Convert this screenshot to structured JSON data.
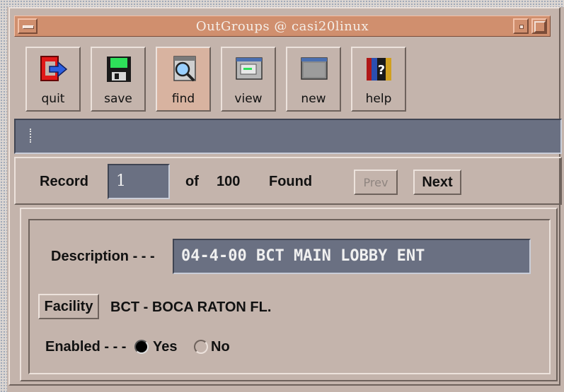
{
  "window": {
    "title": "OutGroups @ casi20linux"
  },
  "toolbar": {
    "buttons": [
      {
        "label": "quit",
        "icon": "quit-exit-icon"
      },
      {
        "label": "save",
        "icon": "floppy-disk-icon"
      },
      {
        "label": "find",
        "icon": "magnifier-icon"
      },
      {
        "label": "view",
        "icon": "window-view-icon"
      },
      {
        "label": "new",
        "icon": "new-window-icon"
      },
      {
        "label": "help",
        "icon": "help-book-icon"
      }
    ]
  },
  "status_message": "",
  "record_nav": {
    "record_label": "Record",
    "current": "1",
    "of_label": "of",
    "total": "100",
    "found_label": "Found",
    "prev_label": "Prev",
    "next_label": "Next"
  },
  "form": {
    "description_label": "Description - - -",
    "description_value": "04-4-00 BCT MAIN LOBBY ENT",
    "facility_button": "Facility",
    "facility_value": "BCT - BOCA RATON FL.",
    "enabled_label": "Enabled - - -",
    "enabled_options": [
      "Yes",
      "No"
    ],
    "enabled_selected": "Yes"
  },
  "colors": {
    "window_bg": "#c4b4ac",
    "titlebar": "#d08f6e",
    "field_bg": "#6a7082",
    "field_text": "#f0f0f0"
  }
}
